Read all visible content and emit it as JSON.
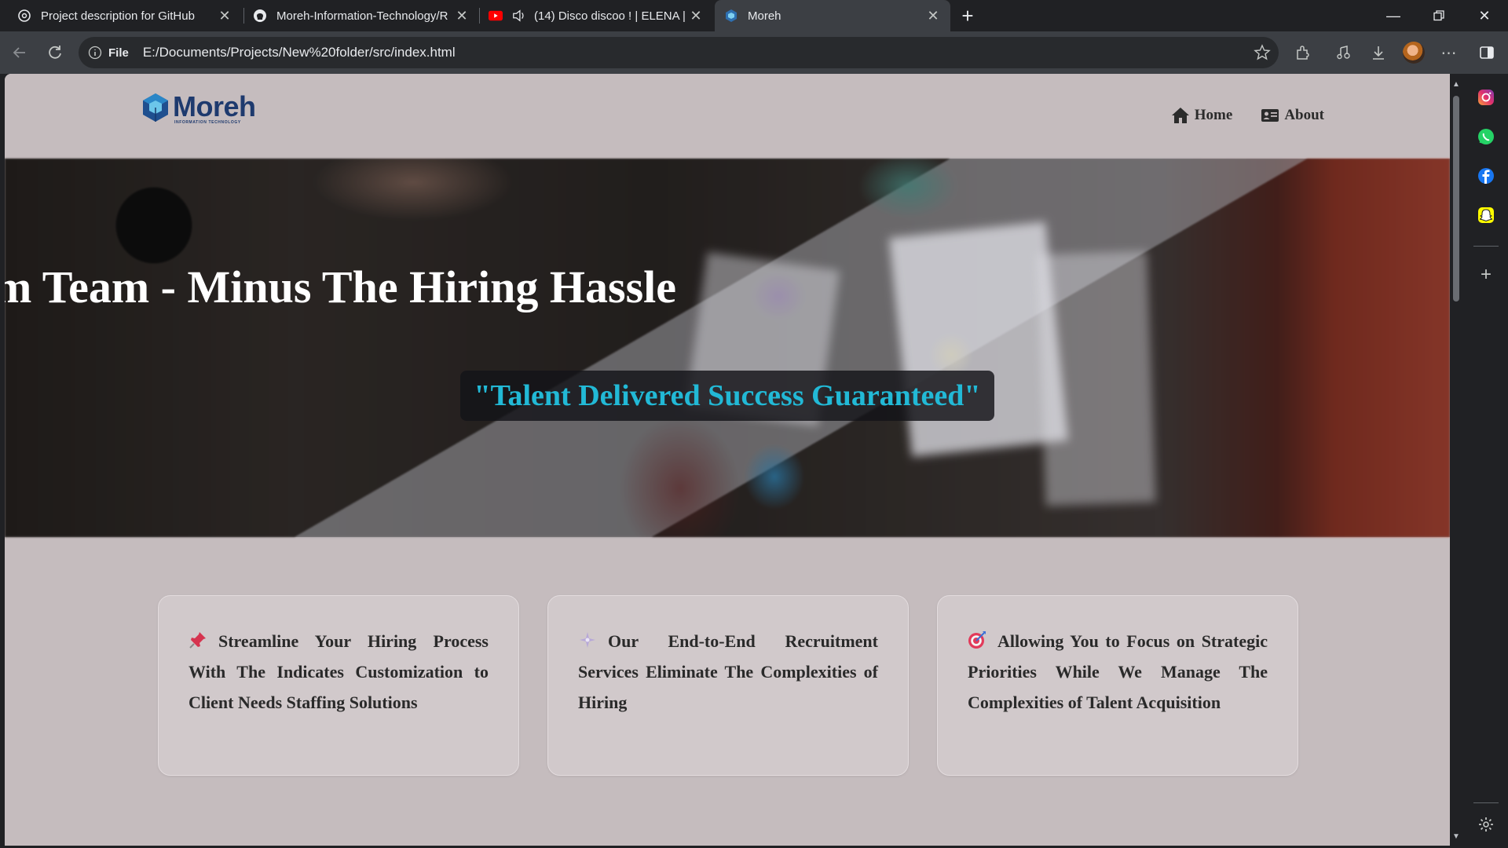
{
  "browser": {
    "tabs": [
      {
        "title": "Project description for GitHub",
        "icon": "chatgpt-icon",
        "active": false
      },
      {
        "title": "Moreh-Information-Technology/R",
        "icon": "github-icon",
        "active": false
      },
      {
        "title": "(14) Disco discoo ! | ELENA |",
        "icon": "youtube-icon",
        "audio": true,
        "active": false
      },
      {
        "title": "Moreh",
        "icon": "moreh-icon",
        "active": true
      }
    ],
    "address": {
      "scheme_label": "File",
      "url": "E:/Documents/Projects/New%20folder/src/index.html"
    },
    "side_panel_icons": [
      "instagram-icon",
      "whatsapp-icon",
      "facebook-icon",
      "snapchat-icon",
      "add-icon",
      "settings-icon"
    ]
  },
  "site": {
    "logo": {
      "word": "Moreh",
      "subtitle": "INFORMATION TECHNOLOGY"
    },
    "nav": [
      {
        "label": "Home",
        "icon": "home-icon"
      },
      {
        "label": "About",
        "icon": "id-card-icon"
      }
    ],
    "hero": {
      "title": "m Team - Minus The Hiring Hassle",
      "tagline": "\"Talent Delivered Success Guaranteed\""
    },
    "cards": [
      {
        "emoji": "pushpin-icon",
        "text": "Streamline Your Hiring Process With The Indicates Customization to Client Needs Staffing Solutions"
      },
      {
        "emoji": "sparkle-icon",
        "text": "Our End-to-End Recruitment Services Eliminate The Complexities of Hiring"
      },
      {
        "emoji": "target-icon",
        "text": "Allowing You to Focus on Strategic Priorities While We Manage The Complexities of Talent Acquisition"
      }
    ]
  },
  "colors": {
    "page_bg": "#c5bcbe",
    "tagline_text": "#22b9d6",
    "logo": "#1e3a6e",
    "chrome_dark": "#202124",
    "chrome_toolbar": "#3c3f44"
  }
}
